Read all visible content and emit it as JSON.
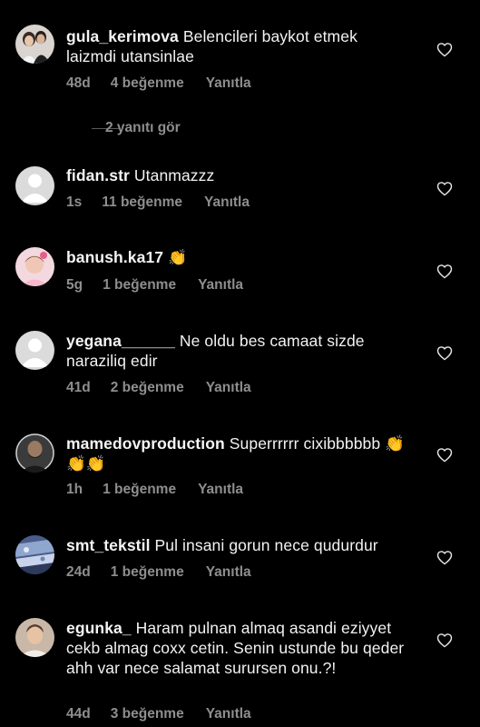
{
  "comments": [
    {
      "username": "gula_kerimova",
      "text": "Belencileri  baykot etmek laizmdi utansinlae",
      "time": "48d",
      "likes": "4 beğenme",
      "reply": "Yanıtla",
      "view_replies": "2 yanıtı gör"
    },
    {
      "username": "fidan.str",
      "text": "Utanmazzz",
      "time": "1s",
      "likes": "11 beğenme",
      "reply": "Yanıtla"
    },
    {
      "username": "banush.ka17",
      "text": "👏",
      "time": "5g",
      "likes": "1 beğenme",
      "reply": "Yanıtla"
    },
    {
      "username": "yegana______",
      "text": "Ne oldu bes camaat sizde naraziliq edir",
      "time": "41d",
      "likes": "2 beğenme",
      "reply": "Yanıtla"
    },
    {
      "username": "mamedovproduction",
      "text": "Superrrrrr cixibbbbbb 👏👏👏",
      "time": "1h",
      "likes": "1 beğenme",
      "reply": "Yanıtla"
    },
    {
      "username": "smt_tekstil",
      "text": "Pul insani gorun nece qudurdur",
      "time": "24d",
      "likes": "1 beğenme",
      "reply": "Yanıtla"
    },
    {
      "username": "egunka_",
      "text": "Haram pulnan almaq asandi eziyyet cekb almag coxx cetin. Senin ustunde bu qeder ahh var nece salamat surursen onu.?!",
      "time": "44d",
      "likes": "3 beğenme",
      "reply": "Yanıtla"
    }
  ],
  "icons": {
    "like": "heart-outline-icon"
  },
  "colors": {
    "background": "#000000",
    "text": "#f5f5f5",
    "secondary": "#8e8e8e"
  }
}
